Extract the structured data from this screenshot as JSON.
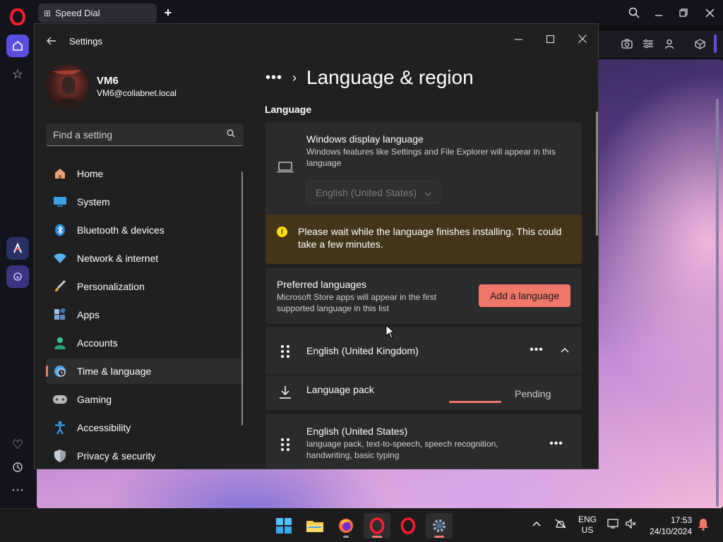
{
  "browser": {
    "tab_title": "Speed Dial",
    "new_tab_symbol": "+",
    "controls": {
      "search_icon": "search-icon",
      "minimize_icon": "minimize-icon",
      "restore_icon": "restore-icon",
      "close_icon": "close-icon"
    },
    "sidebar_icons": [
      "opera-logo",
      "home-icon",
      "star-icon",
      "aria-icon",
      "music-icon",
      "heart-icon",
      "history-icon",
      "more-icon"
    ],
    "toolbar_icons": [
      "camera-icon",
      "sliders-icon",
      "profile-icon",
      "cube-icon"
    ]
  },
  "settings": {
    "window_title": "Settings",
    "user": {
      "name": "VM6",
      "email": "VM6@collabnet.local"
    },
    "search": {
      "placeholder": "Find a setting"
    },
    "nav": [
      {
        "label": "Home",
        "icon": "home-icon",
        "color": "#e9a37b"
      },
      {
        "label": "System",
        "icon": "system-icon",
        "color": "#3aa3e3"
      },
      {
        "label": "Bluetooth & devices",
        "icon": "bluetooth-icon",
        "color": "#2b88d8"
      },
      {
        "label": "Network & internet",
        "icon": "wifi-icon",
        "color": "#5ab4f0"
      },
      {
        "label": "Personalization",
        "icon": "brush-icon",
        "color": "#e8a456"
      },
      {
        "label": "Apps",
        "icon": "apps-icon",
        "color": "#7aa6d8"
      },
      {
        "label": "Accounts",
        "icon": "accounts-icon",
        "color": "#3ec28a"
      },
      {
        "label": "Time & language",
        "icon": "time-language-icon",
        "color": "#4aa8e8",
        "active": true
      },
      {
        "label": "Gaming",
        "icon": "gaming-icon",
        "color": "#b9b9b9"
      },
      {
        "label": "Accessibility",
        "icon": "accessibility-icon",
        "color": "#3a9be6"
      },
      {
        "label": "Privacy & security",
        "icon": "shield-icon",
        "color": "#9aa3ad"
      }
    ],
    "breadcrumb": {
      "more": "•••",
      "separator": "›",
      "title": "Language & region"
    },
    "language_section": {
      "heading": "Language",
      "display_language": {
        "title": "Windows display language",
        "description": "Windows features like Settings and File Explorer will appear in this language",
        "selected": "English (United States)"
      },
      "warning": "Please wait while the language finishes installing. This could take a few minutes.",
      "preferred": {
        "title": "Preferred languages",
        "description": "Microsoft Store apps will appear in the first supported language in this list",
        "add_button": "Add a language"
      },
      "languages": [
        {
          "name": "English (United Kingdom)",
          "expanded": true,
          "pack": {
            "label": "Language pack",
            "status": "Pending",
            "progress_pct": 100
          }
        },
        {
          "name": "English (United States)",
          "features": "language pack, text-to-speech, speech recognition, handwriting, basic typing"
        }
      ]
    }
  },
  "taskbar": {
    "apps": [
      "windows-start-icon",
      "file-explorer-icon",
      "firefox-icon",
      "opera-icon",
      "opera-icon",
      "settings-icon"
    ],
    "tray": {
      "lang_top": "ENG",
      "lang_bottom": "US"
    },
    "clock": {
      "time": "17:53",
      "date": "24/10/2024"
    },
    "accent": "#f0786a"
  }
}
